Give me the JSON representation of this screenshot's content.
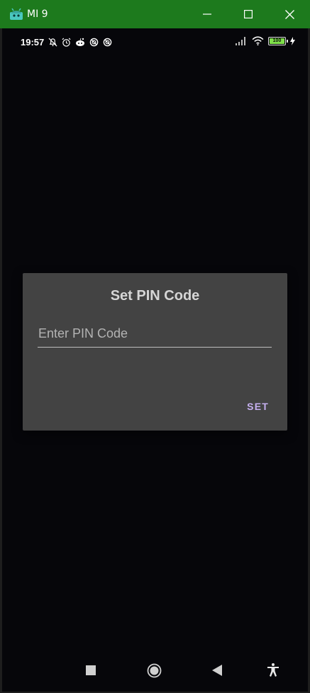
{
  "window": {
    "title": "MI 9",
    "accent": "#1d7a1d"
  },
  "status_bar": {
    "time": "19:57",
    "battery_level": "100",
    "icons_left": [
      "mute-bell-icon",
      "alarm-icon",
      "reddit-icon",
      "blocked-icon",
      "blocked-icon"
    ],
    "icons_right": [
      "signal-icon",
      "wifi-icon",
      "battery-icon",
      "charging-icon"
    ]
  },
  "dialog": {
    "title": "Set PIN Code",
    "input": {
      "value": "",
      "placeholder": "Enter PIN Code"
    },
    "set_label": "SET",
    "accent": "#c6b0f0"
  },
  "nav_bar": {
    "buttons": [
      "recents-icon",
      "home-icon",
      "back-icon",
      "accessibility-icon"
    ]
  }
}
